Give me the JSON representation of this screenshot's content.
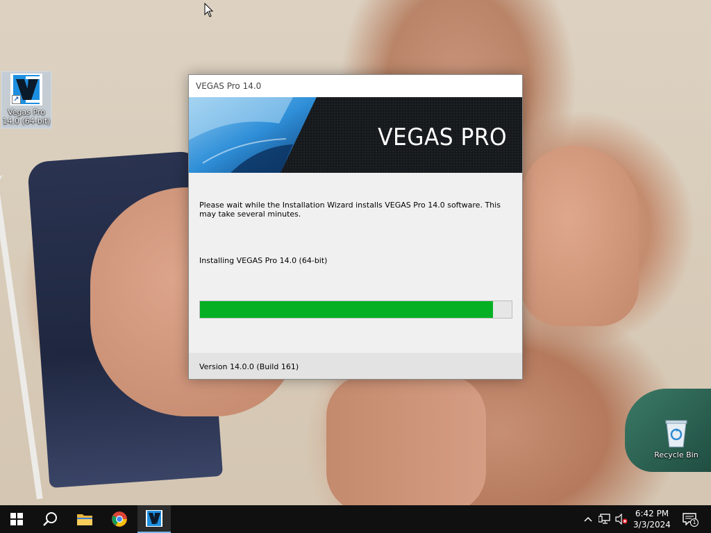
{
  "desktop": {
    "icons": [
      {
        "label": "Vegas Pro 14.0 (64-bit)",
        "icon": "vegas-pro-icon"
      },
      {
        "label": "Recycle Bin",
        "icon": "recycle-bin-icon"
      }
    ]
  },
  "dialog": {
    "title": "VEGAS Pro 14.0",
    "banner_title": "VEGAS PRO",
    "description": "Please wait while the Installation Wizard installs VEGAS Pro 14.0 software. This may take several minutes.",
    "status": "Installing VEGAS Pro 14.0 (64-bit)",
    "progress_fraction": 0.94,
    "footer_version": "Version 14.0.0 (Build 161)",
    "colors": {
      "progress": "#06b025",
      "banner_bg": "#16191c",
      "banner_accent": "#2e8fd8"
    }
  },
  "taskbar": {
    "buttons": [
      {
        "name": "start",
        "icon": "windows-logo-icon"
      },
      {
        "name": "search",
        "icon": "search-icon"
      },
      {
        "name": "file-explorer",
        "icon": "folder-icon"
      },
      {
        "name": "chrome",
        "icon": "chrome-icon"
      },
      {
        "name": "vegas-installer",
        "icon": "vegas-pro-icon",
        "active": true
      }
    ],
    "tray": {
      "icons": [
        "chevron-up-icon",
        "network-icon",
        "volume-muted-icon"
      ],
      "time": "6:42 PM",
      "date": "3/3/2024",
      "notification_count": "1"
    }
  }
}
